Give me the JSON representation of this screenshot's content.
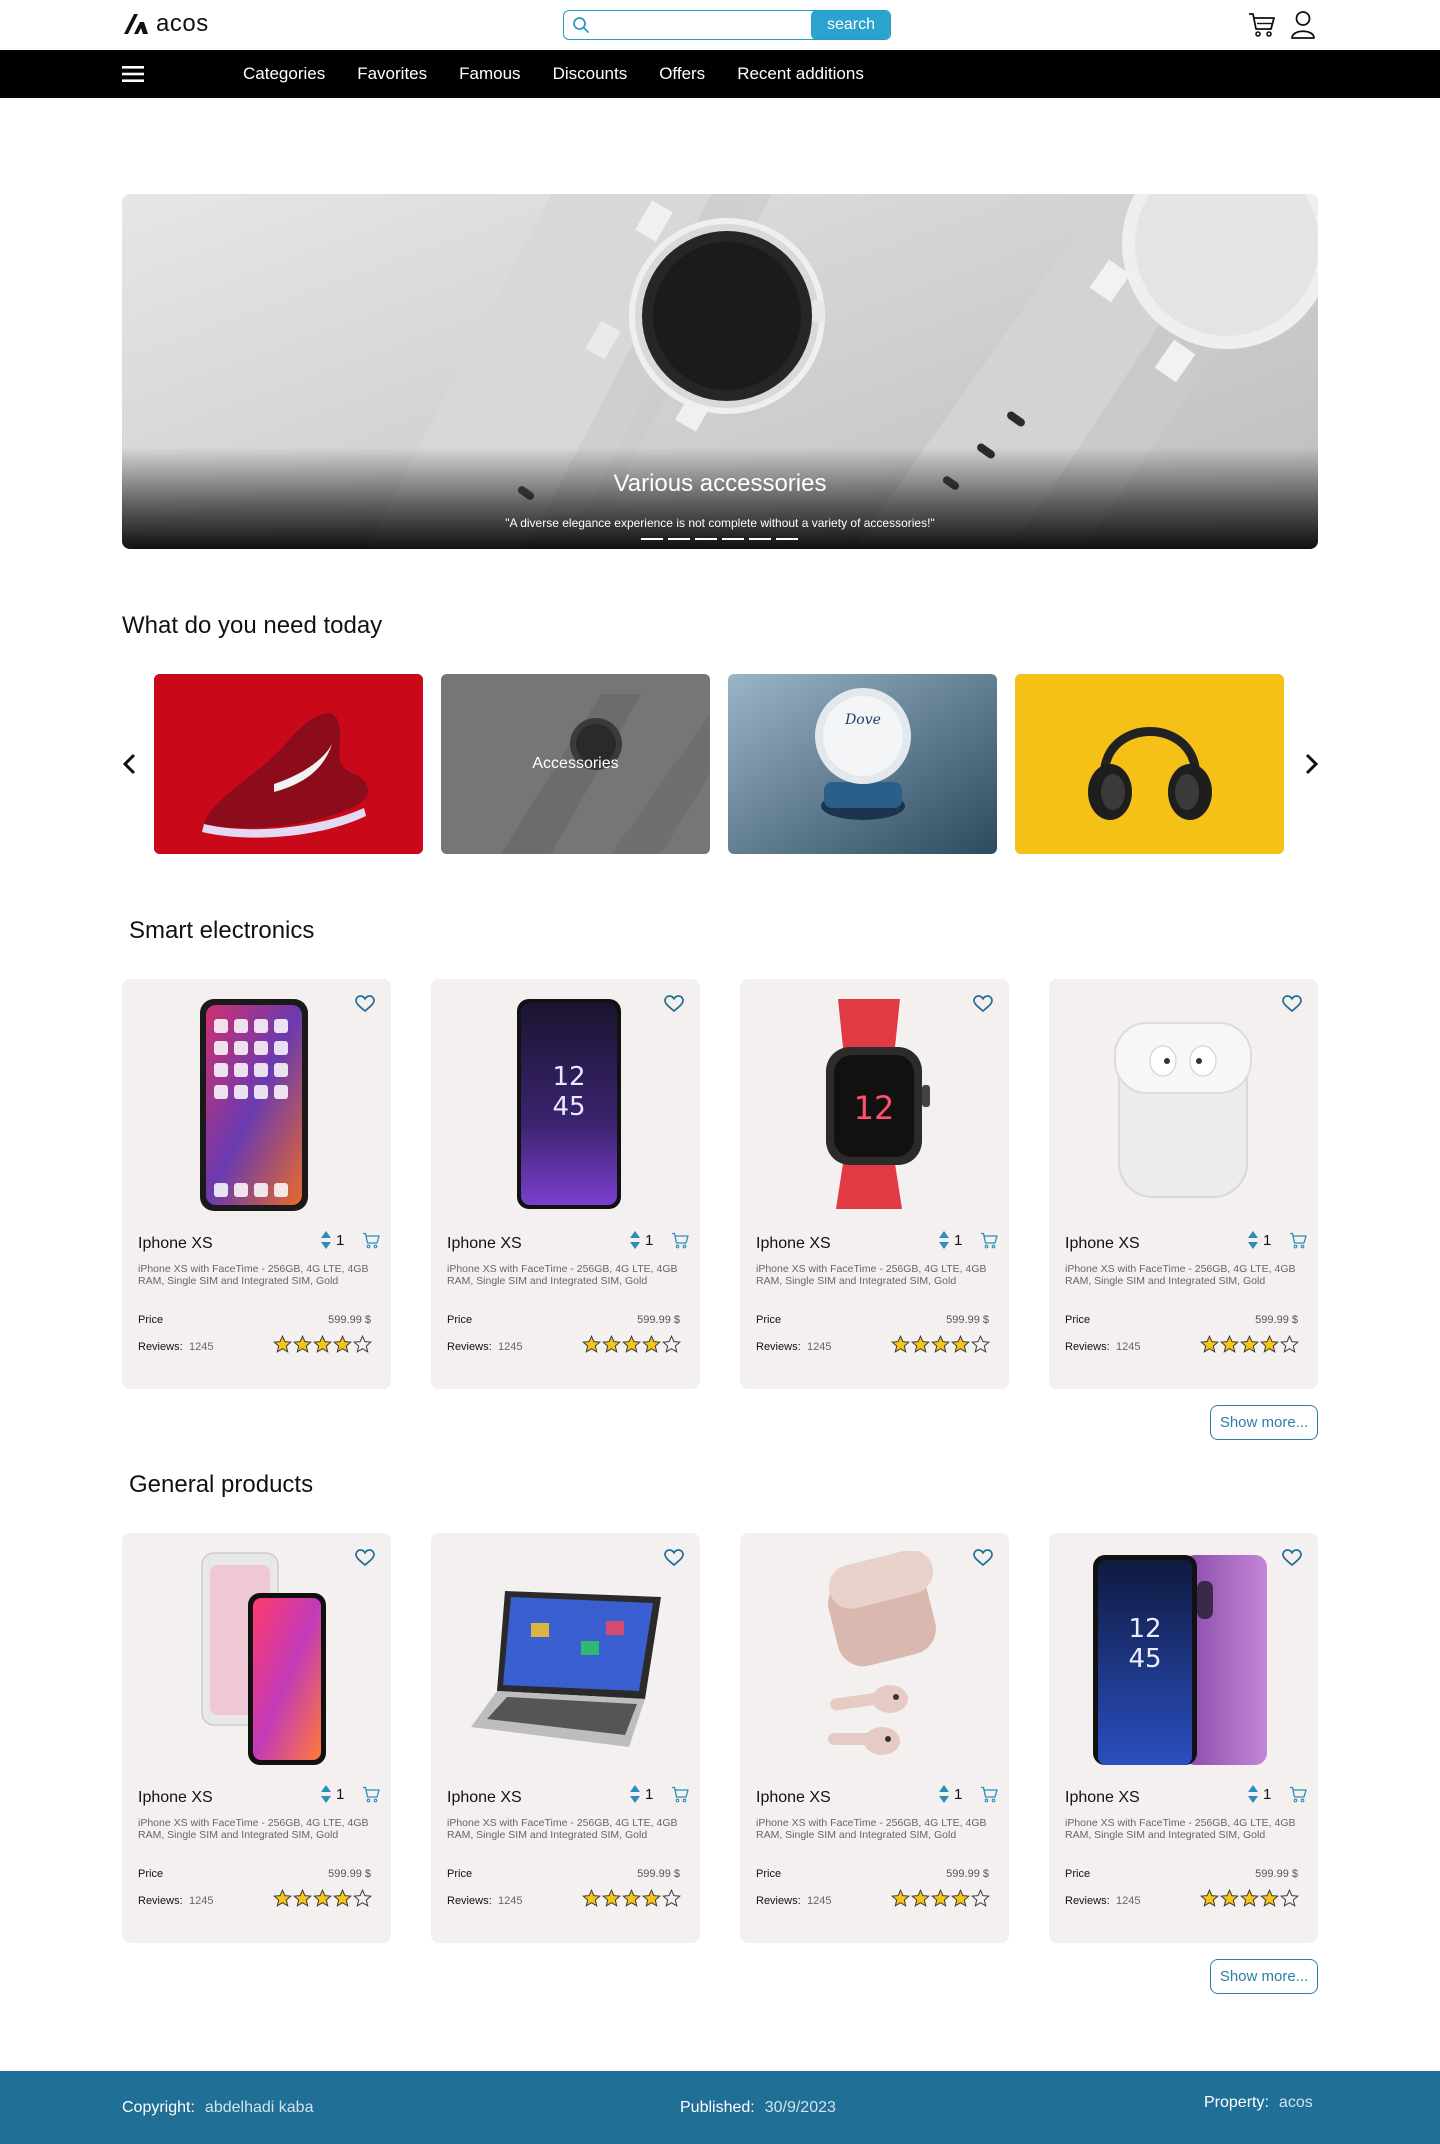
{
  "brand": {
    "name": "acos"
  },
  "search": {
    "placeholder": "",
    "button_label": "search"
  },
  "nav": {
    "items": [
      "Categories",
      "Favorites",
      "Famous",
      "Discounts",
      "Offers",
      "Recent additions"
    ]
  },
  "hero": {
    "title": "Various accessories",
    "subtitle": "\"A diverse elegance experience is not complete without a variety of accessories!\"",
    "slide_count": 6
  },
  "categories": {
    "title": "What do you need today",
    "items": [
      {
        "label": "",
        "image": "red-sneaker"
      },
      {
        "label": "Accessories",
        "image": "smartwatch"
      },
      {
        "label": "",
        "image": "dove-cream"
      },
      {
        "label": "",
        "image": "headphones"
      }
    ]
  },
  "sections": [
    {
      "title": "Smart electronics",
      "show_more": "Show more...",
      "products": [
        {
          "name": "Iphone XS",
          "qty": "1",
          "desc": "iPhone XS with FaceTime - 256GB, 4G LTE, 4GB RAM, Single SIM and Integrated SIM, Gold",
          "price_label": "Price",
          "price": "599.99 $",
          "reviews_label": "Reviews:",
          "reviews": "1245",
          "rating": 4,
          "image": "iphone"
        },
        {
          "name": "Iphone XS",
          "qty": "1",
          "desc": "iPhone XS with FaceTime - 256GB, 4G LTE, 4GB RAM, Single SIM and Integrated SIM, Gold",
          "price_label": "Price",
          "price": "599.99 $",
          "reviews_label": "Reviews:",
          "reviews": "1245",
          "rating": 4,
          "image": "galaxy"
        },
        {
          "name": "Iphone XS",
          "qty": "1",
          "desc": "iPhone XS with FaceTime - 256GB, 4G LTE, 4GB RAM, Single SIM and Integrated SIM, Gold",
          "price_label": "Price",
          "price": "599.99 $",
          "reviews_label": "Reviews:",
          "reviews": "1245",
          "rating": 4,
          "image": "watch"
        },
        {
          "name": "Iphone XS",
          "qty": "1",
          "desc": "iPhone XS with FaceTime - 256GB, 4G LTE, 4GB RAM, Single SIM and Integrated SIM, Gold",
          "price_label": "Price",
          "price": "599.99 $",
          "reviews_label": "Reviews:",
          "reviews": "1245",
          "rating": 4,
          "image": "airpods"
        }
      ]
    },
    {
      "title": "General products",
      "show_more": "Show more...",
      "products": [
        {
          "name": "Iphone XS",
          "qty": "1",
          "desc": "iPhone XS with FaceTime - 256GB, 4G LTE, 4GB RAM, Single SIM and Integrated SIM, Gold",
          "price_label": "Price",
          "price": "599.99 $",
          "reviews_label": "Reviews:",
          "reviews": "1245",
          "rating": 4,
          "image": "iphone-pair"
        },
        {
          "name": "Iphone XS",
          "qty": "1",
          "desc": "iPhone XS with FaceTime - 256GB, 4G LTE, 4GB RAM, Single SIM and Integrated SIM, Gold",
          "price_label": "Price",
          "price": "599.99 $",
          "reviews_label": "Reviews:",
          "reviews": "1245",
          "rating": 4,
          "image": "laptop"
        },
        {
          "name": "Iphone XS",
          "qty": "1",
          "desc": "iPhone XS with FaceTime - 256GB, 4G LTE, 4GB RAM, Single SIM and Integrated SIM, Gold",
          "price_label": "Price",
          "price": "599.99 $",
          "reviews_label": "Reviews:",
          "reviews": "1245",
          "rating": 4,
          "image": "airpods-pink"
        },
        {
          "name": "Iphone XS",
          "qty": "1",
          "desc": "iPhone XS with FaceTime - 256GB, 4G LTE, 4GB RAM, Single SIM and Integrated SIM, Gold",
          "price_label": "Price",
          "price": "599.99 $",
          "reviews_label": "Reviews:",
          "reviews": "1245",
          "rating": 4,
          "image": "galaxy-pair"
        }
      ]
    }
  ],
  "footer": {
    "copyright_label": "Copyright:",
    "copyright_value": "abdelhadi kaba",
    "published_label": "Published:",
    "published_value": "30/9/2023",
    "property_label": "Property:",
    "property_value": "acos"
  },
  "colors": {
    "accent": "#2aa3cf",
    "nav_bg": "#000000",
    "footer_bg": "#1f6f96",
    "card_bg": "#f4f0ef",
    "star": "#f5c518"
  }
}
